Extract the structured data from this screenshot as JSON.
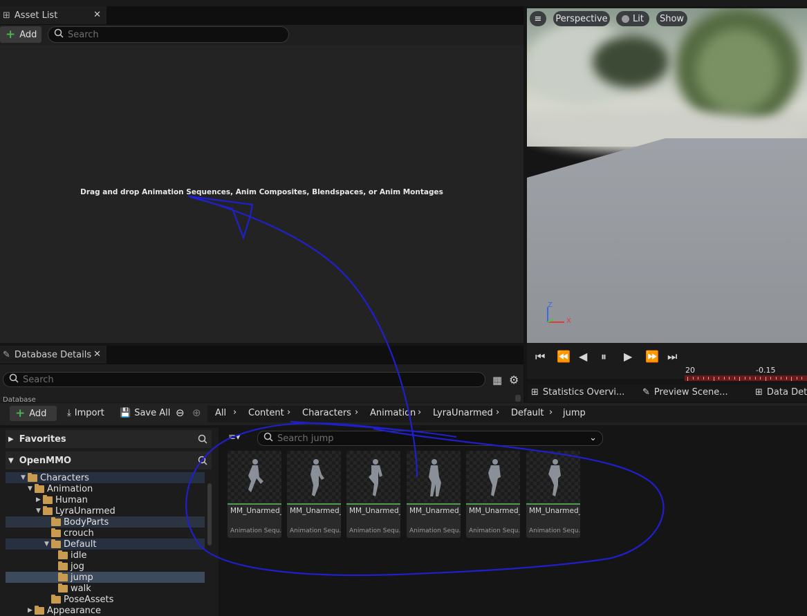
{
  "asset_list": {
    "tab_title": "Asset List",
    "add_label": "Add",
    "search_placeholder": "Search",
    "drop_hint": "Drag and drop Animation Sequences, Anim Composites, Blendspaces, or Anim Montages"
  },
  "viewport": {
    "view_mode": "Perspective",
    "lighting": "Lit",
    "show_label": "Show",
    "axis_z": "Z",
    "axis_x": "X"
  },
  "timeline": {
    "tick_left": "20",
    "tick_right": "-0.15"
  },
  "bottom_tabs": [
    "Statistics Overvi...",
    "Preview Scene...",
    "Data Deta"
  ],
  "database_details": {
    "tab_title": "Database Details",
    "search_placeholder": "Search",
    "cut_text": "Database"
  },
  "content_browser": {
    "add_label": "Add",
    "import_label": "Import",
    "save_all_label": "Save All",
    "breadcrumb": [
      "All",
      "Content",
      "Characters",
      "Animation",
      "LyraUnarmed",
      "Default",
      "jump"
    ],
    "search_placeholder": "Search jump",
    "favorites_label": "Favorites",
    "project_label": "OpenMMO",
    "tree": [
      "Characters",
      "Animation",
      "Human",
      "LyraUnarmed",
      "BodyParts",
      "crouch",
      "Default",
      "idle",
      "jog",
      "jump",
      "walk",
      "PoseAssets",
      "Appearance"
    ],
    "selected_folder": "jump",
    "assets": [
      {
        "name": "MM_Unarmed_",
        "type": "Animation Sequ..."
      },
      {
        "name": "MM_Unarmed_",
        "type": "Animation Sequ..."
      },
      {
        "name": "MM_Unarmed_",
        "type": "Animation Sequ..."
      },
      {
        "name": "MM_Unarmed_",
        "type": "Animation Sequ..."
      },
      {
        "name": "MM_Unarmed_",
        "type": "Animation Sequ..."
      },
      {
        "name": "MM_Unarmed_",
        "type": "Animation Sequ..."
      }
    ]
  },
  "colors": {
    "annotation_stroke": "#1f1fcc",
    "accent_green": "#4fb04f",
    "folder": "#c89b50",
    "selection": "#3d4a5c"
  }
}
